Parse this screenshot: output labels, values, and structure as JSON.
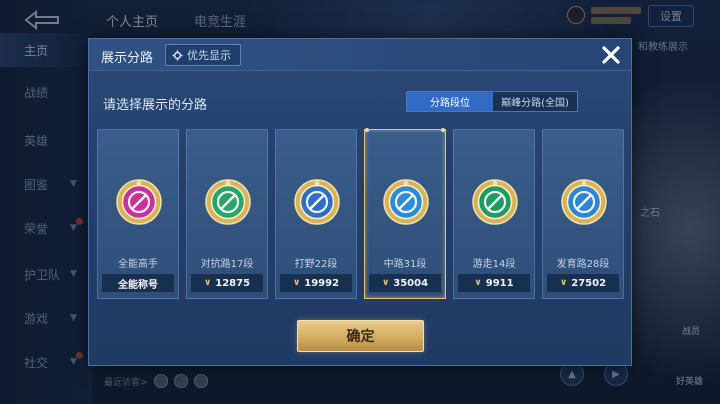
{
  "background": {
    "sidebar": {
      "items": [
        {
          "label": "主页",
          "active": true,
          "chevron": false,
          "badge": false
        },
        {
          "label": "战绩",
          "chevron": false,
          "badge": false
        },
        {
          "label": "英雄",
          "chevron": false,
          "badge": false
        },
        {
          "label": "图鉴",
          "chevron": true,
          "badge": false
        },
        {
          "label": "荣誉",
          "chevron": true,
          "badge": true
        },
        {
          "label": "护卫队",
          "chevron": true,
          "badge": false
        },
        {
          "label": "游戏",
          "chevron": true,
          "badge": false
        },
        {
          "label": "社交",
          "chevron": true,
          "badge": true
        }
      ]
    },
    "top_tabs": [
      "个人主页",
      "电竞生涯"
    ],
    "top_right_button": "设置",
    "right_hint": "和教练展示",
    "right_hint2": "之石",
    "visitors_label": "最近访客>",
    "hero_label": "好英雄",
    "hero_label2": "战员"
  },
  "modal": {
    "title": "展示分路",
    "priority_button": "优先显示",
    "prompt": "请选择展示的分路",
    "segments": [
      {
        "label": "分路段位",
        "active": true
      },
      {
        "label": "巅峰分路(全国)",
        "active": false
      }
    ],
    "cards": [
      {
        "name": "全能高手",
        "score": "全能称号",
        "show_chevron": false,
        "emblem": "allround-emblem-icon",
        "color": "#c6319b",
        "selected": false
      },
      {
        "name": "对抗路17段",
        "score": "12875",
        "show_chevron": true,
        "emblem": "clash-lane-emblem-icon",
        "color": "#2aa36c",
        "selected": false
      },
      {
        "name": "打野22段",
        "score": "19992",
        "show_chevron": true,
        "emblem": "jungle-emblem-icon",
        "color": "#2f6fc3",
        "selected": false
      },
      {
        "name": "中路31段",
        "score": "35004",
        "show_chevron": true,
        "emblem": "mid-lane-emblem-icon",
        "color": "#2b8bd8",
        "selected": true
      },
      {
        "name": "游走14段",
        "score": "9911",
        "show_chevron": true,
        "emblem": "roam-emblem-icon",
        "color": "#1f9a63",
        "selected": false
      },
      {
        "name": "发育路28段",
        "score": "27502",
        "show_chevron": true,
        "emblem": "farm-lane-emblem-icon",
        "color": "#2d86d3",
        "selected": false
      }
    ],
    "confirm_button": "确定"
  }
}
